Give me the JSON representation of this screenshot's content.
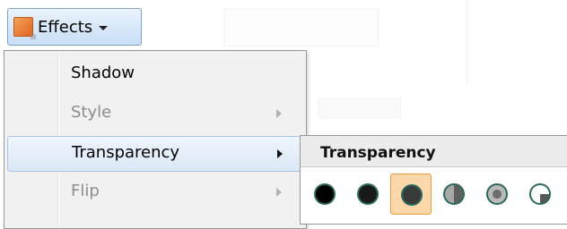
{
  "toolbar": {
    "effects_button": {
      "label": "Effects",
      "icon": "effects-icon",
      "caret": "chevron-down-icon"
    }
  },
  "effects_menu": {
    "items": [
      {
        "label": "Shadow",
        "enabled": true,
        "has_submenu": false,
        "highlighted": false
      },
      {
        "label": "Style",
        "enabled": false,
        "has_submenu": true,
        "highlighted": false
      },
      {
        "label": "Transparency",
        "enabled": true,
        "has_submenu": true,
        "highlighted": true
      },
      {
        "label": "Flip",
        "enabled": false,
        "has_submenu": true,
        "highlighted": false
      }
    ]
  },
  "transparency_submenu": {
    "title": "Transparency",
    "selected_index": 2,
    "swatch_count": 6
  },
  "colors": {
    "accent_highlight": "#dbe8f6",
    "selection_orange": "#fcd7a9",
    "swatch_ring": "#2a6a5e"
  }
}
